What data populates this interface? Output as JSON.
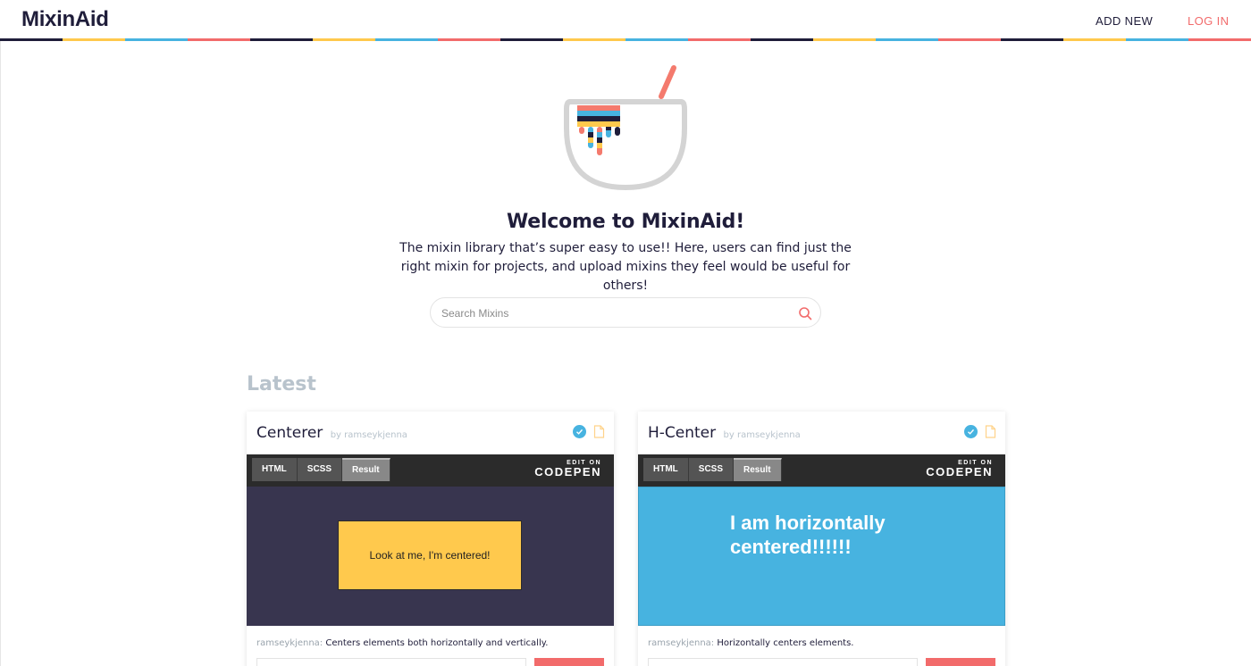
{
  "header": {
    "logo": "MixinAid",
    "nav": {
      "add_new": "ADD NEW",
      "log_in": "LOG IN"
    },
    "stripe_colors": [
      "#1f1d3a",
      "#ffc94d",
      "#47b3e0",
      "#f26b6b"
    ]
  },
  "hero": {
    "title": "Welcome to MixinAid!",
    "description": "The mixin library that’s super easy to use!! Here, users can find just the right mixin for projects, and upload mixins they feel would be useful for others!",
    "bowl_icon": "mixing-bowl-icon"
  },
  "search": {
    "placeholder": "Search Mixins",
    "value": "",
    "icon": "search-icon"
  },
  "latest": {
    "heading": "Latest",
    "cards": [
      {
        "title": "Centerer",
        "by": "by ramseykjenna",
        "tabs": [
          "HTML",
          "SCSS",
          "Result"
        ],
        "active_tab": "Result",
        "codepen_edit": "EDIT ON",
        "codepen_brand": "CODEPEN",
        "demo_text": "Look at me, I'm centered!",
        "author": "ramseykjenna:",
        "description": "Centers elements both horizontally and vertically."
      },
      {
        "title": "H-Center",
        "by": "by ramseykjenna",
        "tabs": [
          "HTML",
          "SCSS",
          "Result"
        ],
        "active_tab": "Result",
        "codepen_edit": "EDIT ON",
        "codepen_brand": "CODEPEN",
        "demo_text": "I am horizontally centered!!!!!!",
        "author": "ramseykjenna:",
        "description": "Horizontally centers elements."
      }
    ]
  },
  "colors": {
    "navy": "#1f1d3a",
    "coral": "#f26b6b",
    "yellow": "#ffc94d",
    "blue": "#47b3e0",
    "muted": "#b8c3cc"
  }
}
